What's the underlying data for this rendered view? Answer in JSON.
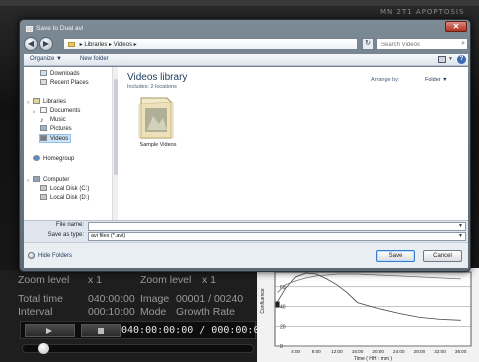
{
  "background_app": {
    "title_fragment": "MN 2T1 APOPTOSIS",
    "info": {
      "zoom_label_1": "Zoom level",
      "zoom_value_1": "x 1",
      "zoom_label_2": "Zoom level",
      "zoom_value_2": "x 1",
      "total_time_label": "Total time",
      "total_time_value": "040:00:00",
      "image_label": "Image",
      "image_value": "00001 / 00240",
      "interval_label": "Interval",
      "interval_value": "000:10:00",
      "mode_label": "Mode",
      "mode_value": "Growth Rate"
    },
    "playback": {
      "time_display": "040:00:00:00 / 000:00:00:00",
      "slider_fraction": 0.07
    }
  },
  "chart_data": {
    "type": "line",
    "title": "",
    "xlabel": "Time ( HH : mm )",
    "ylabel": "Confluence",
    "x_ticks": [
      "4:00",
      "8:00",
      "12:00",
      "16:00",
      "20:00",
      "24:00",
      "28:00",
      "32:00",
      "36:00"
    ],
    "y_ticks": [
      0,
      20,
      40,
      60
    ],
    "ylim": [
      0,
      75
    ],
    "xlim": [
      0,
      38
    ],
    "series": [
      {
        "name": "",
        "x": [
          0.5,
          2,
          4,
          6,
          8,
          10,
          12,
          14,
          16,
          20,
          24,
          28,
          32,
          36
        ],
        "y": [
          45,
          58,
          70,
          74,
          73,
          68,
          62,
          54,
          44,
          38,
          33,
          29,
          27,
          26
        ]
      },
      {
        "name": "",
        "x": [
          0.5,
          2,
          4,
          6,
          8,
          10,
          12,
          16,
          20,
          24,
          28,
          32,
          36
        ],
        "y": [
          54,
          62,
          66,
          69,
          71,
          72,
          73,
          73,
          72,
          71,
          70,
          69,
          68
        ]
      }
    ],
    "marker": {
      "x": 0.5,
      "y": 42
    }
  },
  "dialog": {
    "title": "Save to Dual avi",
    "close_label": "✕",
    "breadcrumb": [
      "Libraries",
      "Videos"
    ],
    "search_placeholder": "Search Videos",
    "toolbar": {
      "organize": "Organize ▼",
      "new_folder": "New folder",
      "view_dd": "▼",
      "help": "?"
    },
    "nav": {
      "downloads": "Downloads",
      "recent_places": "Recent Places",
      "libraries": "Libraries",
      "documents": "Documents",
      "music": "Music",
      "pictures": "Pictures",
      "videos": "Videos",
      "homegroup": "Homegroup",
      "computer": "Computer",
      "local_disk_c": "Local Disk (C:)",
      "local_disk_d": "Local Disk (D:)"
    },
    "main": {
      "library_title": "Videos library",
      "library_sub": "Includes: 2 locations",
      "arrange_label": "Arrange by:",
      "arrange_value": "Folder ▼",
      "folder_name": "Sample Videos"
    },
    "form": {
      "file_name_label": "File name:",
      "file_name_value": "sample dual avi",
      "save_as_type_label": "Save as type:",
      "save_as_type_value": "avi files (*.avi)"
    },
    "footer": {
      "hide_folders": "Hide Folders",
      "save": "Save",
      "cancel": "Cancel"
    }
  }
}
